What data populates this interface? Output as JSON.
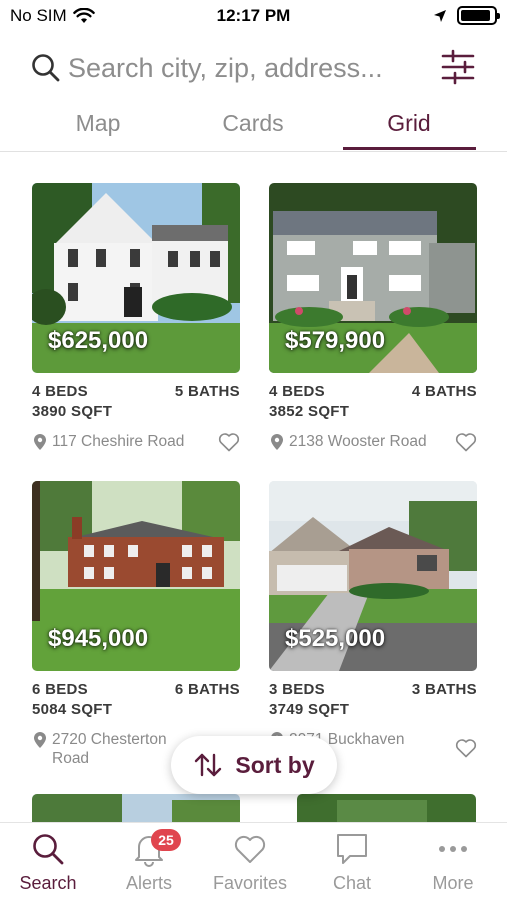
{
  "status_bar": {
    "carrier": "No SIM",
    "time": "12:17 PM",
    "battery_level": 0.9
  },
  "search": {
    "placeholder": "Search city, zip, address..."
  },
  "tabs": [
    {
      "label": "Map",
      "active": false
    },
    {
      "label": "Cards",
      "active": false
    },
    {
      "label": "Grid",
      "active": true
    }
  ],
  "listings": [
    {
      "price": "$625,000",
      "beds": "4 BEDS",
      "baths": "5 BATHS",
      "sqft": "3890 SQFT",
      "address": "117 Cheshire Road"
    },
    {
      "price": "$579,900",
      "beds": "4 BEDS",
      "baths": "4 BATHS",
      "sqft": "3852 SQFT",
      "address": "2138 Wooster Road"
    },
    {
      "price": "$945,000",
      "beds": "6 BEDS",
      "baths": "6 BATHS",
      "sqft": "5084 SQFT",
      "address": "2720 Chesterton Road"
    },
    {
      "price": "$525,000",
      "beds": "3 BEDS",
      "baths": "3 BATHS",
      "sqft": "3749 SQFT",
      "address": "2071 Buckhaven"
    }
  ],
  "sort": {
    "label": "Sort by"
  },
  "nav": [
    {
      "label": "Search",
      "icon": "search-icon",
      "active": true
    },
    {
      "label": "Alerts",
      "icon": "bell-icon",
      "badge": "25"
    },
    {
      "label": "Favorites",
      "icon": "heart-icon"
    },
    {
      "label": "Chat",
      "icon": "chat-icon"
    },
    {
      "label": "More",
      "icon": "more-icon"
    }
  ],
  "colors": {
    "accent": "#5a1d3c",
    "badge": "#e0454e",
    "muted": "#8d8d8d"
  }
}
